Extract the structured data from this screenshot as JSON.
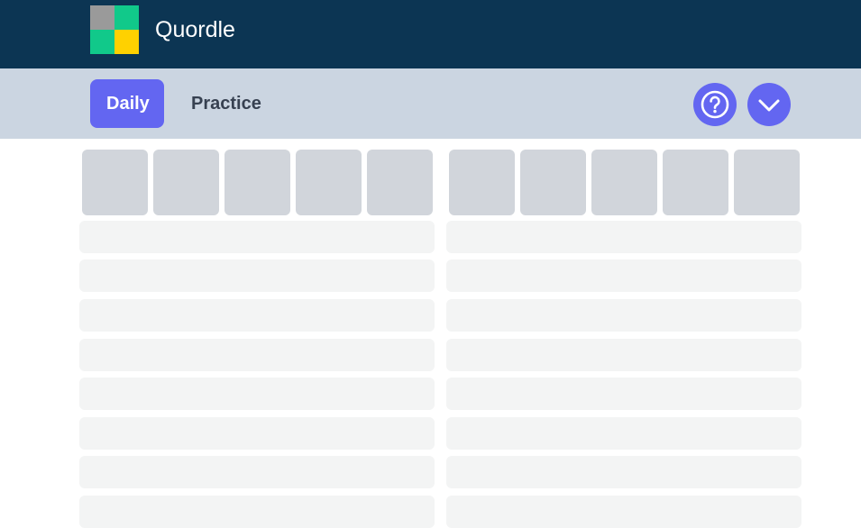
{
  "header": {
    "title": "Quordle",
    "logo_colors": [
      "#9a9a9a",
      "#11c98a",
      "#11c98a",
      "#ffd100"
    ]
  },
  "nav": {
    "tabs": [
      {
        "label": "Daily",
        "active": true
      },
      {
        "label": "Practice",
        "active": false
      }
    ],
    "help_icon": "question-circle-icon",
    "more_icon": "chevron-down-icon"
  },
  "colors": {
    "header_bg": "#0c3553",
    "nav_bg": "#cbd5e1",
    "accent": "#6366f1",
    "tile_bg": "#d1d5db",
    "row_bg": "#f3f4f4"
  }
}
